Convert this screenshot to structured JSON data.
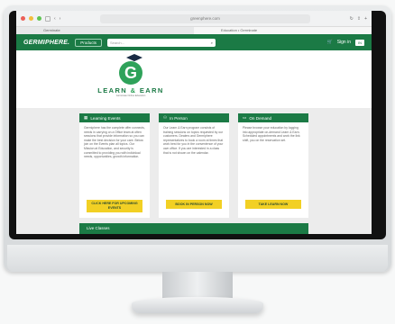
{
  "browser": {
    "url": "greenphere.com",
    "tab_left": "Germinate",
    "tab_right": "Education • Germinate"
  },
  "header": {
    "brand": "GERMIPHERE.",
    "products_label": "Products",
    "search_placeholder": "Search...",
    "signin_label": "Sign in",
    "account_label": "IN"
  },
  "logo": {
    "letter": "G",
    "word1": "LEARN",
    "amp": "&",
    "word2": "EARN",
    "tagline": "Germinate Online Education"
  },
  "cards": [
    {
      "title": "Learning Events",
      "body": "Germiphere has the complete offer connects, needs in carrying on a Office team at often sessions that provide information so you can make the best decision for your care. Below join on the Events plan all topics. Our Mission at Education, and security is committed to providing you with individual needs, opportunities, growth information.",
      "button": "CLICK HERE FOR UPCOMING EVENTS"
    },
    {
      "title": "In Person",
      "body": "Our Learn & Earn program consists of training sessions on topics requested by our customers. Dealers and Germiphere representatives to book a room at times that work best for you in the convenience of your own office. If you are interested in a class that is not shown on the calendar.",
      "button": "BOOK IN PERSON NOW"
    },
    {
      "title": "On Demand",
      "body": "Please browse your education by logging into appropriate on-demand Learn & Earn. Scheduled appointments and work the link shift, you on the reservation set.",
      "button": "TAKE LEARN NOW"
    }
  ],
  "bottom_section": "Live Classes",
  "colors": {
    "brand_green": "#1b7a45",
    "accent_yellow": "#f2d024"
  }
}
